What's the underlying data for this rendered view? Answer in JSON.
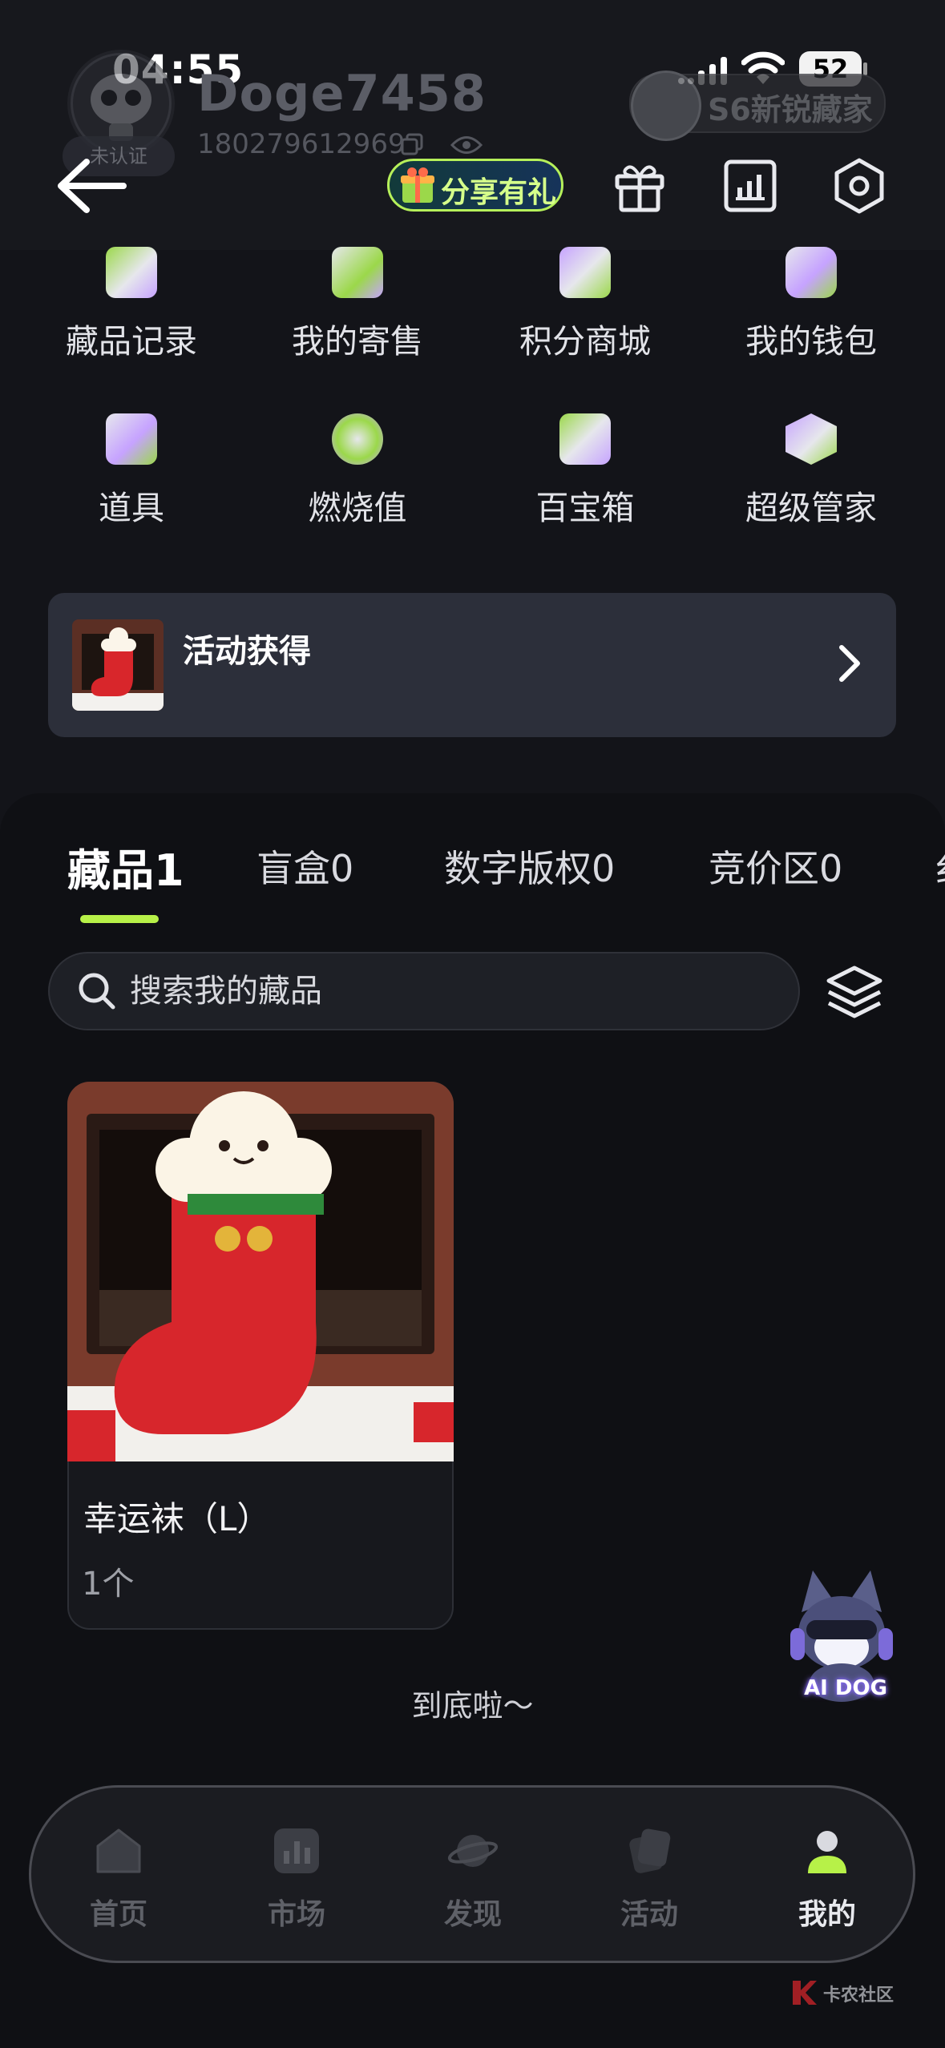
{
  "status_bar": {
    "time": "04:55",
    "battery": "52"
  },
  "profile": {
    "username": "Doge7458",
    "phone": "180279612969",
    "verify_badge": "未认证",
    "level_badge": "S6新锐藏家"
  },
  "header": {
    "share_label": "分享有礼"
  },
  "grid": {
    "items": [
      {
        "label": "藏品记录",
        "icon": "collection-record-icon"
      },
      {
        "label": "我的寄售",
        "icon": "consignment-icon"
      },
      {
        "label": "积分商城",
        "icon": "points-mall-icon"
      },
      {
        "label": "我的钱包",
        "icon": "wallet-icon"
      },
      {
        "label": "道具",
        "icon": "props-icon"
      },
      {
        "label": "燃烧值",
        "icon": "flame-icon"
      },
      {
        "label": "百宝箱",
        "icon": "treasure-box-icon"
      },
      {
        "label": "超级管家",
        "icon": "butler-icon"
      }
    ]
  },
  "banner": {
    "title": "活动获得"
  },
  "tabs": [
    {
      "label": "藏品1"
    },
    {
      "label": "盲盒0"
    },
    {
      "label": "数字版权0"
    },
    {
      "label": "竞价区0"
    },
    {
      "label": "纟"
    }
  ],
  "search": {
    "placeholder": "搜索我的藏品"
  },
  "collection": [
    {
      "title": "幸运袜（L）",
      "count": "1个"
    }
  ],
  "floating": {
    "label": "AI DOG"
  },
  "end_text": "到底啦～",
  "bottom_nav": [
    {
      "label": "首页",
      "icon": "home-icon"
    },
    {
      "label": "市场",
      "icon": "market-icon"
    },
    {
      "label": "发现",
      "icon": "discover-icon"
    },
    {
      "label": "活动",
      "icon": "activity-icon"
    },
    {
      "label": "我的",
      "icon": "profile-icon"
    }
  ],
  "watermark": "卡农社区",
  "colors": {
    "accent": "#b7f148",
    "background": "#131419",
    "banner": "#2c2f3a"
  }
}
